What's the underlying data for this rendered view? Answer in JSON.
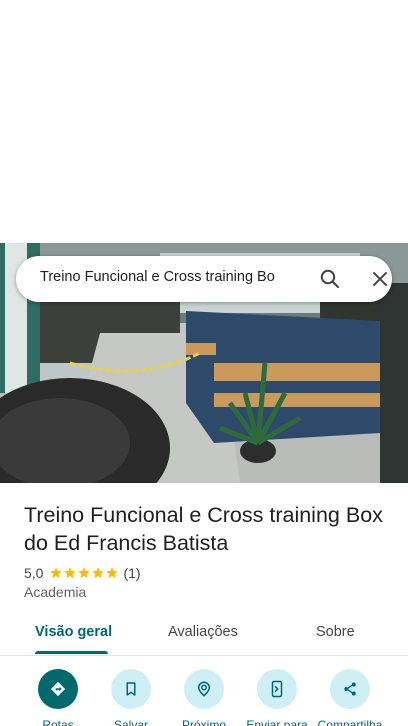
{
  "search": {
    "query": "Treino Funcional e Cross training Bo"
  },
  "place": {
    "name": "Treino Funcional e Cross training Box do Ed Francis Batista",
    "rating": "5,0",
    "review_count": "(1)",
    "stars": 5,
    "category": "Academia"
  },
  "tabs": [
    {
      "label": "Visão geral",
      "active": true
    },
    {
      "label": "Avaliações",
      "active": false
    },
    {
      "label": "Sobre",
      "active": false
    }
  ],
  "actions": [
    {
      "label": "Rotas",
      "icon": "directions-icon"
    },
    {
      "label": "Salvar",
      "icon": "bookmark-icon"
    },
    {
      "label": "Próximo",
      "icon": "nearby-icon"
    },
    {
      "label": "Enviar para",
      "icon": "send-to-phone-icon"
    },
    {
      "label": "Compartilha",
      "icon": "share-icon"
    }
  ],
  "colors": {
    "accent": "#00696d",
    "star": "#fbbc04",
    "action_bg": "#cdeff5"
  }
}
